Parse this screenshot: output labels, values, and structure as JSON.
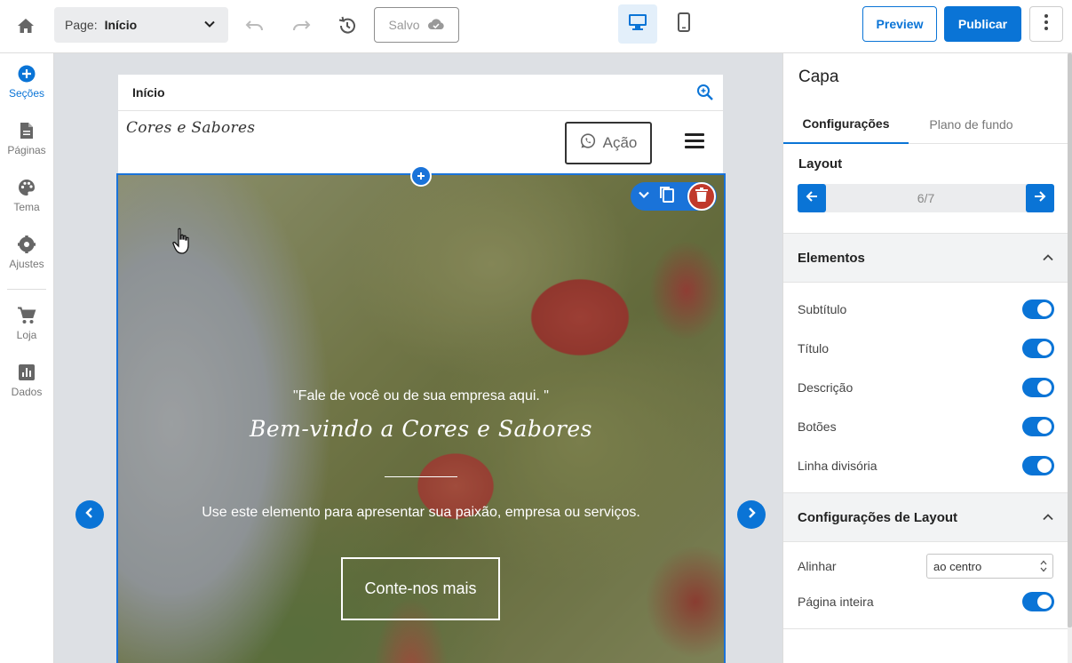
{
  "topbar": {
    "page_label": "Page:",
    "page_value": "Início",
    "saved_label": "Salvo",
    "preview_label": "Preview",
    "publish_label": "Publicar"
  },
  "sidebar": {
    "items": [
      {
        "label": "Seções",
        "icon": "plus-circle-icon"
      },
      {
        "label": "Páginas",
        "icon": "page-icon"
      },
      {
        "label": "Tema",
        "icon": "palette-icon"
      },
      {
        "label": "Ajustes",
        "icon": "gear-icon"
      },
      {
        "label": "Loja",
        "icon": "cart-icon"
      },
      {
        "label": "Dados",
        "icon": "chart-icon"
      }
    ]
  },
  "canvas": {
    "page_title": "Início",
    "site_logo": "Cores e Sabores",
    "action_label": "Ação",
    "hero": {
      "subtitle": "\"Fale de você ou de sua empresa aqui. \"",
      "title": "Bem-vindo a Cores e Sabores",
      "description": "Use este elemento para apresentar sua paixão, empresa ou serviços.",
      "button": "Conte-nos mais"
    }
  },
  "panel": {
    "title": "Capa",
    "tabs": [
      "Configurações",
      "Plano de fundo"
    ],
    "layout_label": "Layout",
    "layout_value": "6/7",
    "elements_header": "Elementos",
    "elements": [
      {
        "label": "Subtítulo",
        "on": true
      },
      {
        "label": "Título",
        "on": true
      },
      {
        "label": "Descrição",
        "on": true
      },
      {
        "label": "Botões",
        "on": true
      },
      {
        "label": "Linha divisória",
        "on": true
      }
    ],
    "layout_settings_header": "Configurações de Layout",
    "align_label": "Alinhar",
    "align_value": "ao centro",
    "fullpage_label": "Página inteira",
    "fullpage_on": true
  },
  "colors": {
    "accent": "#0a74d6",
    "delete": "#c0392b"
  }
}
